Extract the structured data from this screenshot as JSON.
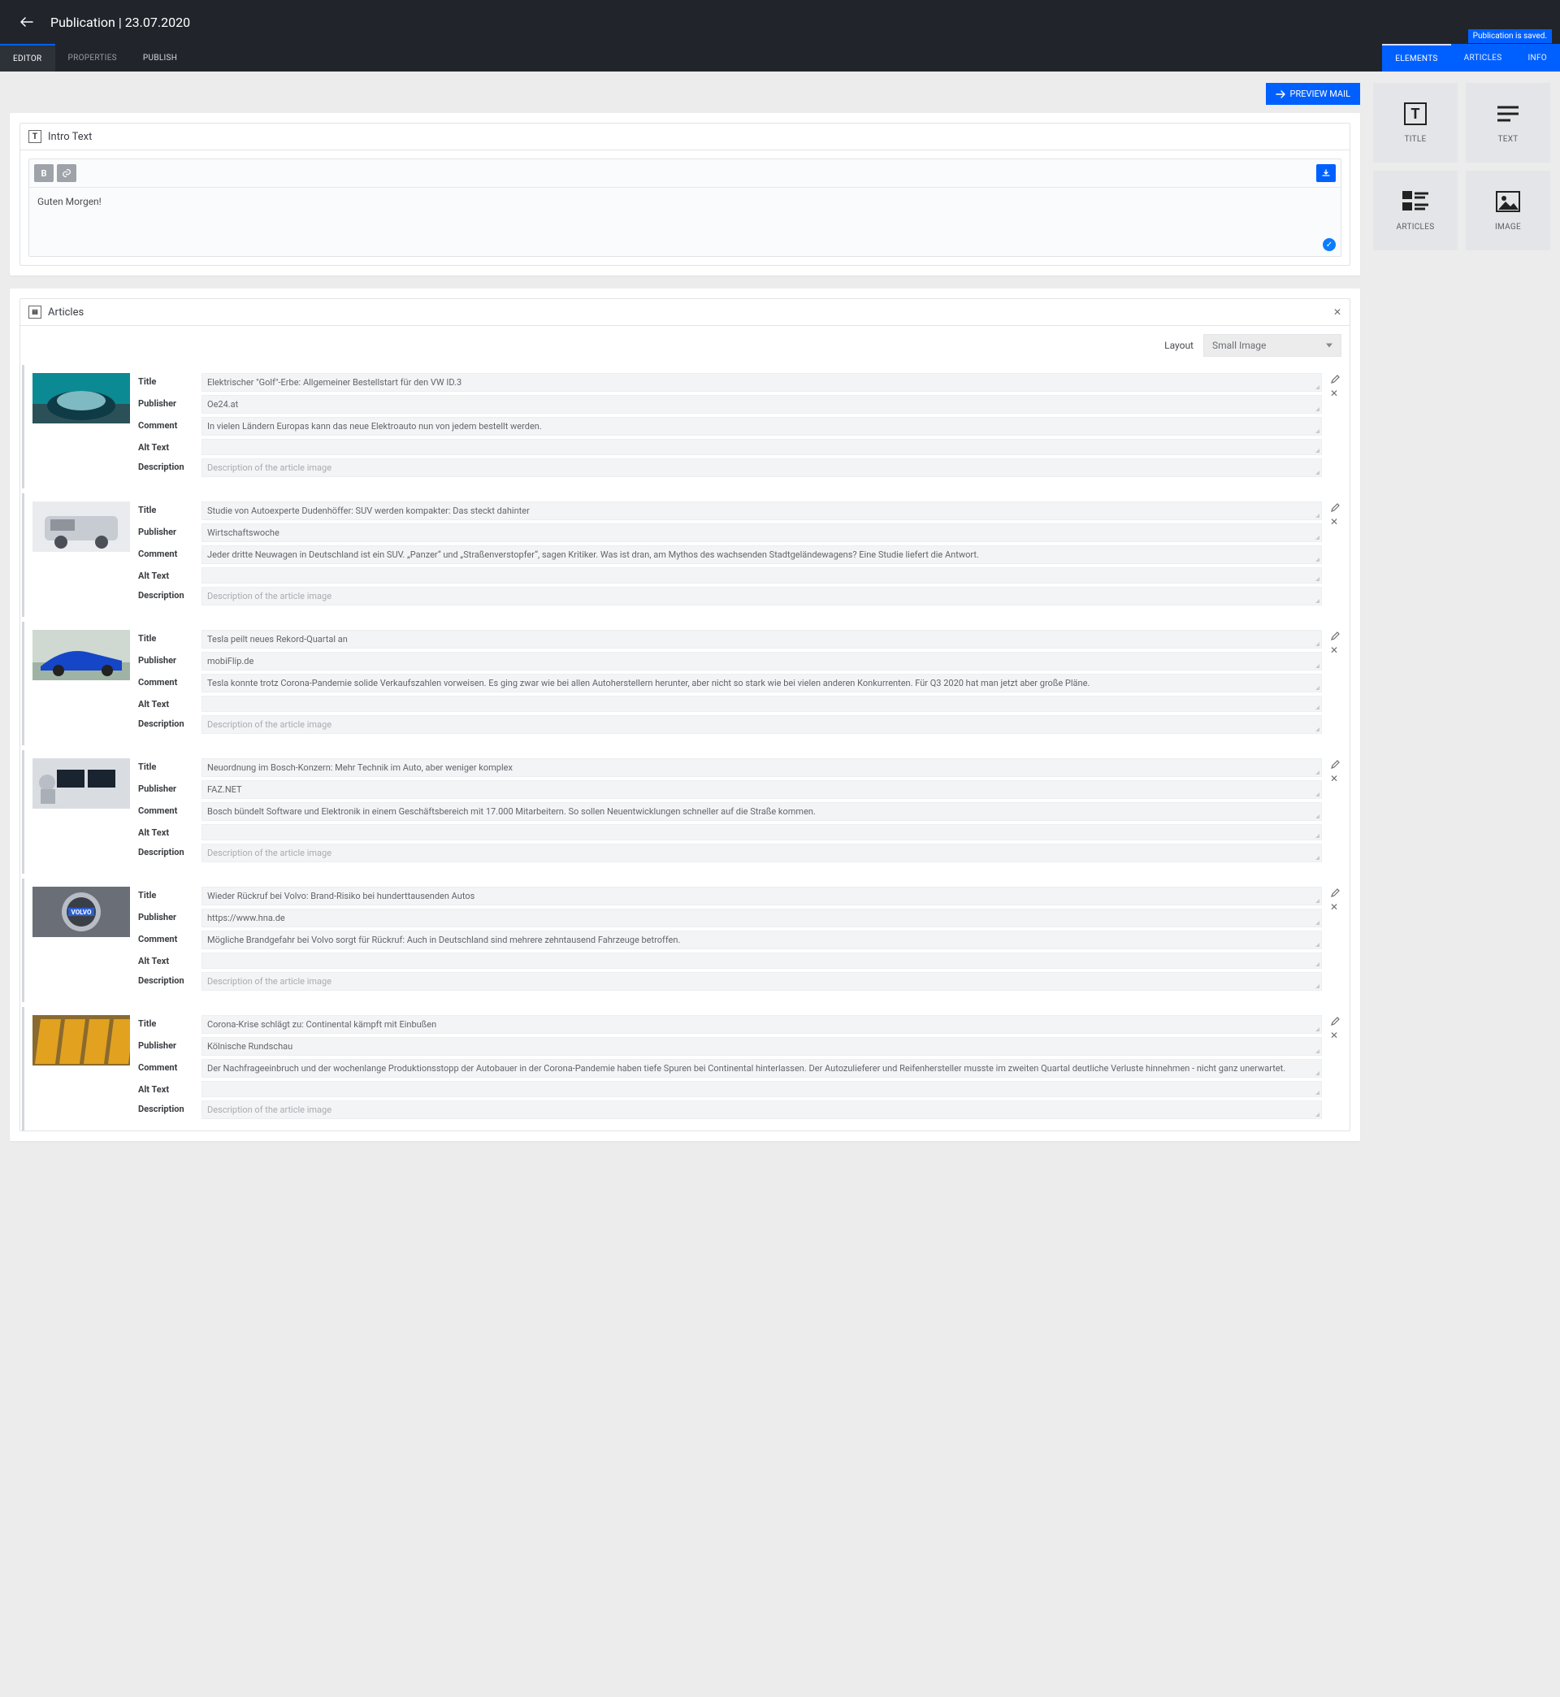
{
  "header": {
    "title": "Publication | 23.07.2020"
  },
  "status": "Publication is saved.",
  "tabs_left": [
    {
      "label": "EDITOR",
      "active": true
    },
    {
      "label": "PROPERTIES",
      "active": false
    },
    {
      "label": "PUBLISH",
      "active": false,
      "light": true
    }
  ],
  "tabs_right": [
    {
      "label": "ELEMENTS",
      "active": true
    },
    {
      "label": "ARTICLES",
      "active": false
    },
    {
      "label": "INFO",
      "active": false
    }
  ],
  "preview_label": "PREVIEW MAIL",
  "intro": {
    "heading": "Intro Text",
    "text": "Guten Morgen!"
  },
  "articles_block": {
    "heading": "Articles",
    "layout_label": "Layout",
    "layout_value": "Small Image"
  },
  "field_labels": {
    "title": "Title",
    "publisher": "Publisher",
    "comment": "Comment",
    "alt": "Alt Text",
    "desc": "Description"
  },
  "desc_placeholder": "Description of the article image",
  "articles": [
    {
      "title": "Elektrischer \"Golf\"-Erbe: Allgemeiner Bestellstart für den VW ID.3",
      "publisher": "Oe24.at",
      "comment": "In vielen Ländern Europas kann das neue Elektroauto nun von jedem bestellt werden.",
      "alt": "",
      "thumb": "teal-car"
    },
    {
      "title": "Studie von Autoexperte Dudenhöffer: SUV werden kompakter: Das steckt dahinter",
      "publisher": "Wirtschaftswoche",
      "comment": "Jeder dritte Neuwagen in Deutschland ist ein SUV. „Panzer“ und „Straßenverstopfer“, sagen Kritiker. Was ist dran, am Mythos des wachsenden Stadtgeländewagens? Eine Studie liefert die Antwort.",
      "alt": "",
      "thumb": "silver-suv"
    },
    {
      "title": "Tesla peilt neues Rekord-Quartal an",
      "publisher": "mobiFlip.de",
      "comment": "Tesla konnte trotz Corona-Pandemie solide Verkaufszahlen vorweisen. Es ging zwar wie bei allen Autoherstellern herunter, aber nicht so stark wie bei vielen anderen Konkurrenten. Für Q3 2020 hat man jetzt aber große Pläne.",
      "alt": "",
      "thumb": "blue-sedan"
    },
    {
      "title": "Neuordnung im Bosch-Konzern: Mehr Technik im Auto, aber weniger komplex",
      "publisher": "FAZ.NET",
      "comment": "Bosch bündelt Software und Elektronik in einem Geschäftsbereich mit 17.000 Mitarbeitern. So sollen Neuentwicklungen schneller auf die Straße kommen.",
      "alt": "",
      "thumb": "monitors"
    },
    {
      "title": "Wieder Rückruf bei Volvo: Brand-Risiko bei hunderttausenden Autos",
      "publisher": "https://www.hna.de",
      "comment": "Mögliche Brandgefahr bei Volvo sorgt für Rückruf: Auch in Deutschland sind mehrere zehntausend Fahrzeuge betroffen.",
      "alt": "",
      "thumb": "volvo-badge"
    },
    {
      "title": "Corona-Krise schlägt zu: Continental kämpft mit Einbußen",
      "publisher": "Kölnische Rundschau",
      "comment": "Der Nachfrageeinbruch und der wochenlange Produktionsstopp der Autobauer in der Corona-Pandemie haben tiefe Spuren bei Continental hinterlassen. Der Autozulieferer und Reifenhersteller musste im zweiten Quartal deutliche Verluste hinnehmen - nicht ganz unerwartet.",
      "alt": "",
      "thumb": "conti-flags"
    }
  ],
  "palette": [
    {
      "label": "TITLE",
      "icon": "title"
    },
    {
      "label": "TEXT",
      "icon": "text"
    },
    {
      "label": "ARTICLES",
      "icon": "articles"
    },
    {
      "label": "IMAGE",
      "icon": "image"
    }
  ]
}
